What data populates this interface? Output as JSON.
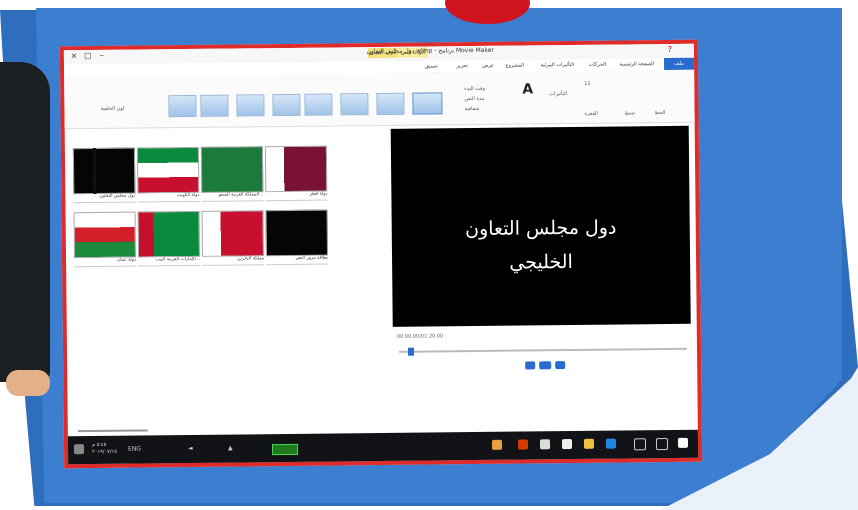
{
  "app": {
    "title": "دول مجلس التعاون.wlmp - برنامج Movie Maker",
    "context_tabs": [
      "أدوات الفيديو",
      "أدوات النص"
    ],
    "file_tab": "ملف",
    "menu_tabs": [
      "الصفحة الرئيسية",
      "الحركات",
      "التأثيرات المرئية",
      "المشروع",
      "عرض",
      "تحرير",
      "تنسيق"
    ]
  },
  "ribbon": {
    "font_size_label": "11",
    "group_labels": [
      "الخط",
      "الفقرة",
      "ضبط",
      "التأثيرات"
    ],
    "big_letter": "A",
    "text_labels": [
      "لون الخلفية",
      "وقت البدء",
      "مدة النص",
      "شفافية"
    ]
  },
  "storyboard": {
    "row1": [
      {
        "label": "دول مجلس التعاون",
        "flag": "black"
      },
      {
        "label": "دولة الكويت",
        "flag": "kuwait"
      },
      {
        "label": "المملكة العربية السعو...",
        "flag": "saudi"
      },
      {
        "label": "دولة قطر",
        "flag": "qatar"
      }
    ],
    "row2": [
      {
        "label": "دولة عمان",
        "flag": "oman"
      },
      {
        "label": "الإمارات العربية المت...",
        "flag": "uae"
      },
      {
        "label": "مملكة البحرين",
        "flag": "bahrain"
      },
      {
        "label": "بطاقة مرور النص",
        "flag": "black"
      }
    ]
  },
  "preview": {
    "line1": "دول مجلس التعاون",
    "line2": "الخليجي",
    "time": "00:00.00/01:20.00",
    "progress": 0.03
  },
  "taskbar": {
    "clock_time": "٥:٤٥ م",
    "clock_date": "٢٠١٩/٠٧/١٥",
    "lang": "ENG"
  }
}
